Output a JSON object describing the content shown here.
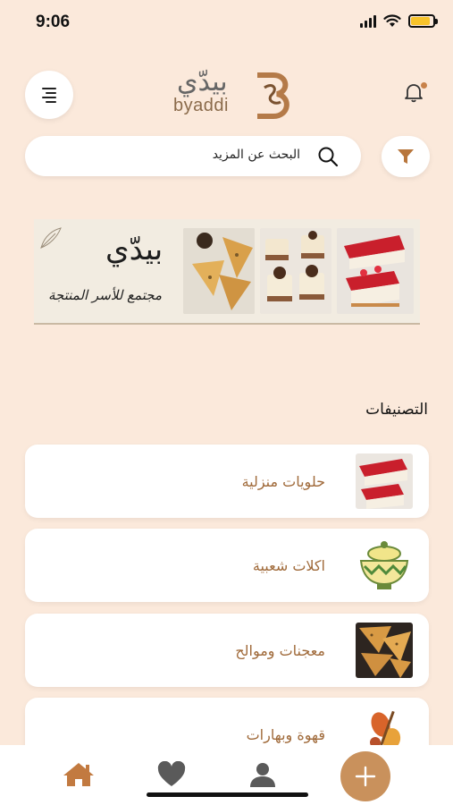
{
  "status_bar": {
    "time": "9:06"
  },
  "header": {
    "logo_ar": "بيدّي",
    "logo_en": "byaddi"
  },
  "search": {
    "placeholder": "البحث عن المزيد"
  },
  "banner": {
    "title": "بيدّي",
    "tagline": "مجتمع للأسر المنتجة"
  },
  "categories": {
    "title": "التصنيفات",
    "items": [
      {
        "label": "حلويات منزلية",
        "icon": "cheesecake-image"
      },
      {
        "label": "اكلات شعبية",
        "icon": "food-bowl-image"
      },
      {
        "label": "معجنات وموالح",
        "icon": "pastry-image"
      },
      {
        "label": "قهوة وبهارات",
        "icon": "spices-image"
      }
    ]
  },
  "bottom_nav": {
    "items": [
      "home-icon",
      "heart-icon",
      "profile-icon",
      "plus-icon"
    ]
  },
  "colors": {
    "background": "#fbe9db",
    "accent": "#c9915c",
    "category_text": "#a06a3a",
    "filter_icon": "#b8763c"
  }
}
